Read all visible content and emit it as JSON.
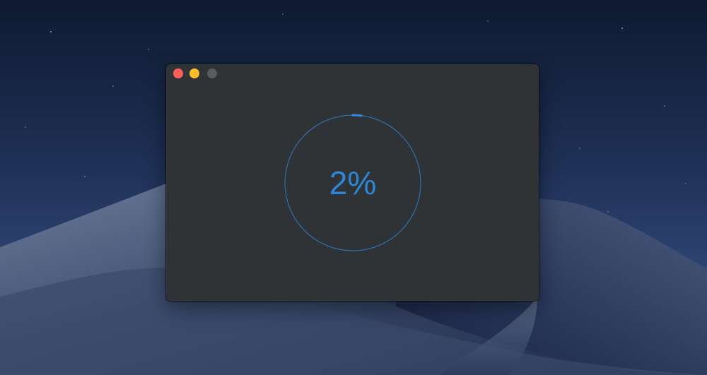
{
  "desktop": {
    "wallpaper": "mojave-night-dunes",
    "colors": {
      "sky_top": "#16233f",
      "sky_bottom": "#2d4470",
      "dune_light": "#5a6b8c",
      "dune_dark": "#1b2641"
    }
  },
  "window": {
    "background_color": "#303335",
    "controls": {
      "close": {
        "icon": "close-icon",
        "color": "#fe5f57"
      },
      "minimize": {
        "icon": "minimize-icon",
        "color": "#febc2e"
      },
      "zoom": {
        "icon": "zoom-icon",
        "color": "#5a5c5e"
      }
    }
  },
  "progress": {
    "percent": 2,
    "label": "2%",
    "track_color": "#2d7bc4",
    "indicator_color": "#2f8ae0",
    "text_color": "#2f86d6"
  }
}
